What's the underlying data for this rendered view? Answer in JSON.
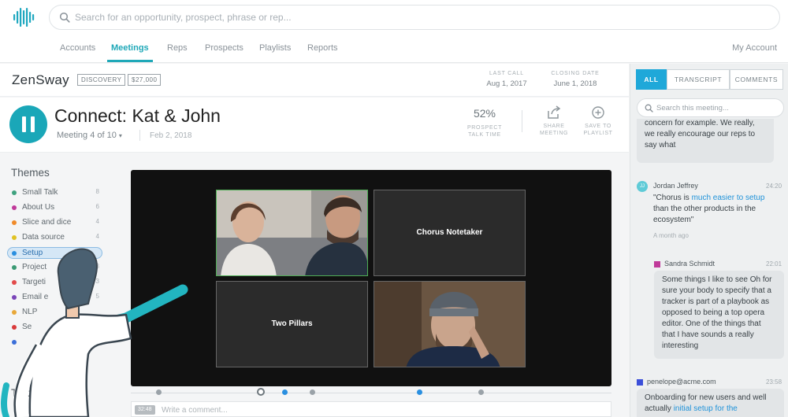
{
  "search": {
    "placeholder": "Search for an opportunity, prospect, phrase or rep..."
  },
  "nav": {
    "items": [
      "Accounts",
      "Meetings",
      "Reps",
      "Prospects",
      "Playlists",
      "Reports"
    ],
    "active": "Meetings",
    "account_label": "My Account"
  },
  "account": {
    "name": "ZenSway",
    "stage_tag": "DISCOVERY",
    "amount_tag": "$27,000",
    "last_call_label": "LAST CALL",
    "last_call_value": "Aug 1, 2017",
    "closing_date_label": "CLOSING DATE",
    "closing_date_value": "June 1, 2018"
  },
  "meeting": {
    "title": "Connect: Kat & John",
    "subtitle": "Meeting 4 of 10",
    "date": "Feb 2, 2018",
    "talk_time_value": "52%",
    "talk_time_label_1": "PROSPECT",
    "talk_time_label_2": "TALK TIME",
    "share_label_1": "SHARE",
    "share_label_2": "MEETING",
    "save_label_1": "SAVE TO",
    "save_label_2": "PLAYLIST"
  },
  "themes": {
    "title": "Themes",
    "items": [
      {
        "name": "Small Talk",
        "count": "8",
        "color": "#3fa27f"
      },
      {
        "name": "About Us",
        "count": "6",
        "color": "#c03a9a"
      },
      {
        "name": "Slice and dice",
        "count": "4",
        "color": "#f08b2a"
      },
      {
        "name": "Data source",
        "count": "4",
        "color": "#e0c224"
      },
      {
        "name": "Setup",
        "count": "",
        "color": "#2a8fe0"
      },
      {
        "name": "Project",
        "count": "3",
        "color": "#3b9a74"
      },
      {
        "name": "Targeti",
        "count": "3",
        "color": "#e24b4b"
      },
      {
        "name": "Email e",
        "count": "5",
        "color": "#7a45b8"
      },
      {
        "name": "NLP",
        "count": "",
        "color": "#e8a83a"
      },
      {
        "name": "Se",
        "count": "",
        "color": "#d93b3b"
      },
      {
        "name": "",
        "count": "",
        "color": "#3b6fd9"
      }
    ],
    "tracks_title": "Trac"
  },
  "video": {
    "tiles": [
      "",
      "Chorus Notetaker",
      "Two Pillars",
      ""
    ]
  },
  "comment": {
    "timestamp": "32:48",
    "placeholder": "Write a comment..."
  },
  "panel": {
    "tabs": [
      "ALL",
      "TRANSCRIPT",
      "COMMENTS"
    ],
    "active_tab": "ALL",
    "search_placeholder": "Search this meeting...",
    "first_bubble": "concern for example. We really, we really encourage our reps to say what",
    "msg1": {
      "initials": "JJ",
      "name": "Jordan Jeffrey",
      "time": "24:20",
      "text_1": "\"Chorus is ",
      "highlight": "much easier to setup",
      "text_2": " than the other products in the ecosystem\"",
      "ago": "A month ago"
    },
    "msg2": {
      "name": "Sandra Schmidt",
      "time": "22:01",
      "text": "Some things I like to see Oh for sure your body to specify that a tracker is part of a playbook as opposed to being a top opera editor. One of the things that that I have sounds a really interesting"
    },
    "msg3": {
      "name": "penelope@acme.com",
      "time": "23:58",
      "text_1": "Onboarding for new users and well actually ",
      "highlight": "initial setup for the"
    },
    "colors": {
      "accent": "#1fa8b8",
      "tab_active": "#1fa8d9"
    }
  }
}
